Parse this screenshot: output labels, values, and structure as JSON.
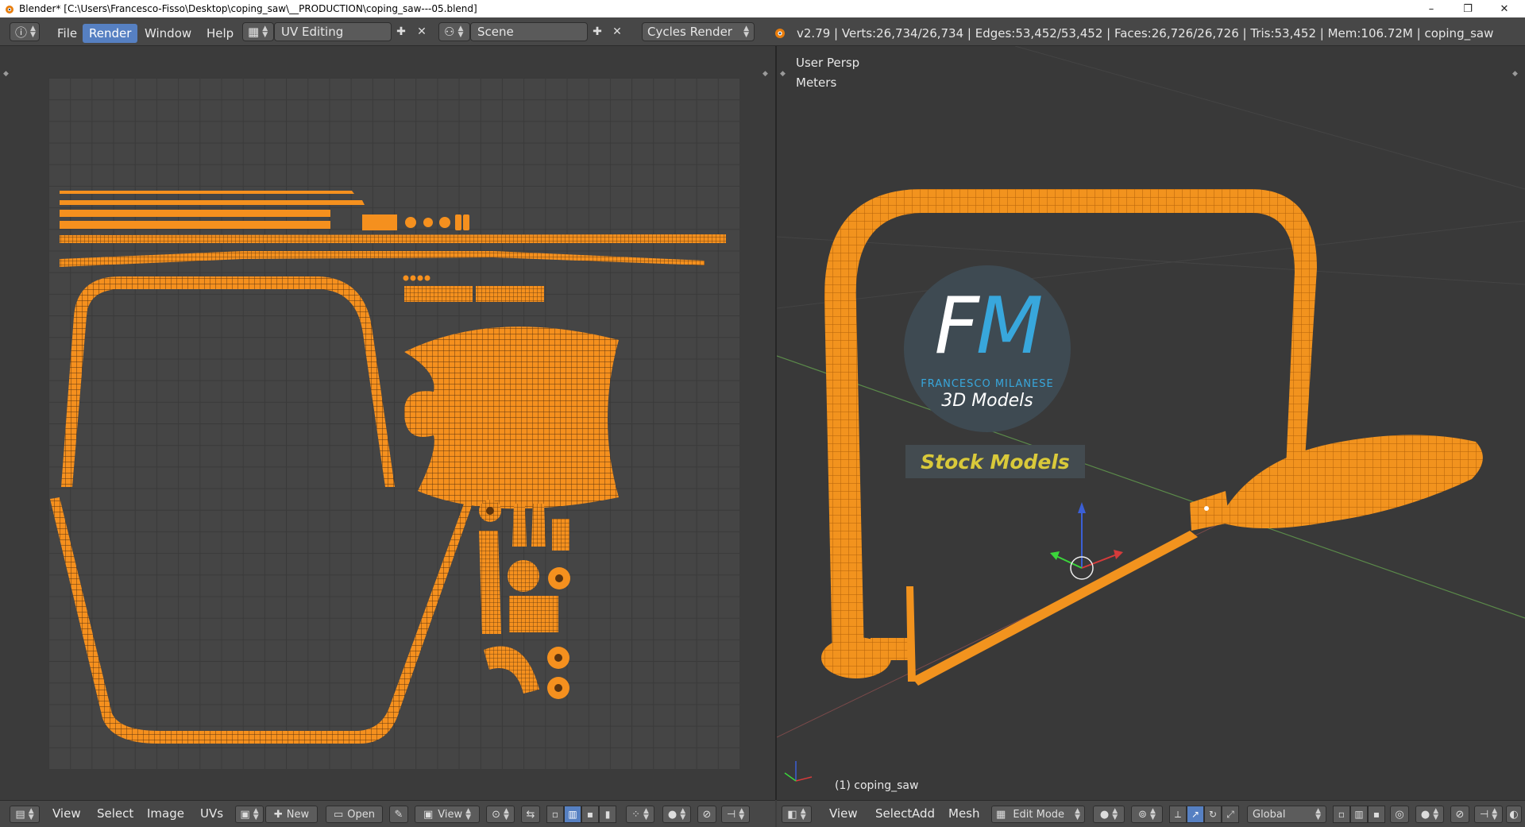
{
  "window": {
    "title": "Blender* [C:\\Users\\Francesco-Fisso\\Desktop\\coping_saw\\__PRODUCTION\\coping_saw---05.blend]",
    "minimize": "–",
    "maximize": "❐",
    "close": "✕"
  },
  "topbar": {
    "menus": [
      "File",
      "Render",
      "Window",
      "Help"
    ],
    "active_menu": "Render",
    "screen_layout": "UV Editing",
    "scene": "Scene",
    "render_engine": "Cycles Render",
    "stats": "v2.79 | Verts:26,734/26,734 | Edges:53,452/53,452 | Faces:26,726/26,726 | Tris:53,452 | Mem:106.72M | coping_saw"
  },
  "viewport": {
    "view_name": "User Persp",
    "units": "Meters",
    "object_label": "(1) coping_saw",
    "logo": {
      "letter_f": "F",
      "letter_m": "M",
      "name": "FRANCESCO MILANESE",
      "subtitle": "3D Models"
    },
    "banner": "Stock Models",
    "accent_color": "#f59a1f"
  },
  "uv_header": {
    "menus": [
      "View",
      "Select",
      "Image",
      "UVs"
    ],
    "new_label": "New",
    "open_label": "Open",
    "view_dropdown": "View"
  },
  "view3d_header": {
    "menus": [
      "View",
      "Select",
      "Add",
      "Mesh"
    ],
    "mode": "Edit Mode",
    "orientation": "Global"
  }
}
